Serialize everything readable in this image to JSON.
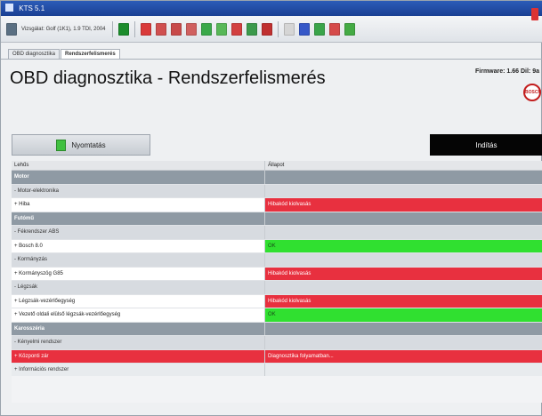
{
  "window": {
    "title": "KTS 5.1"
  },
  "toolbar": {
    "label": "Vizsgálat: Golf (1K1), 1.9 TDI, 2004",
    "buttons": [
      {
        "name": "nav-back-icon",
        "color": "#1c8c2c"
      },
      {
        "name": "stop-icon",
        "color": "#d93a3a"
      },
      {
        "name": "search-icon",
        "color": "#d05050"
      },
      {
        "name": "flash-icon",
        "color": "#c84a4a"
      },
      {
        "name": "info-icon",
        "color": "#d06060"
      },
      {
        "name": "grid-icon",
        "color": "#3aa84a"
      },
      {
        "name": "monitor-icon",
        "color": "#58b858"
      },
      {
        "name": "engine-icon",
        "color": "#d24040"
      },
      {
        "name": "chart-icon",
        "color": "#3c9a4c"
      },
      {
        "name": "gauge-icon",
        "color": "#c03030"
      },
      {
        "name": "doc-icon",
        "color": "#d5d5d5"
      },
      {
        "name": "help-icon",
        "color": "#3658c8"
      },
      {
        "name": "user-icon",
        "color": "#3aa44a"
      },
      {
        "name": "settings-icon",
        "color": "#d54a4a"
      },
      {
        "name": "exit-icon",
        "color": "#44aa44"
      }
    ]
  },
  "tabs": [
    {
      "label": "OBD diagnosztika",
      "active": false
    },
    {
      "label": "Rendszerfelismerés",
      "active": true
    }
  ],
  "page": {
    "title": "OBD diagnosztika - Rendszerfelismerés",
    "firmware": "Firmware: 1.66  Dil: 9a",
    "logo_text": "BOSCH"
  },
  "actions": {
    "print_label": "Nyomtatás",
    "back_label": "Indítás"
  },
  "table": {
    "columns": [
      "Lehűs",
      "Állapot"
    ],
    "rows": [
      {
        "type": "section",
        "c1": "Motor",
        "c2": ""
      },
      {
        "type": "group",
        "c1": "- Motor-elektronika",
        "c2": ""
      },
      {
        "type": "item err",
        "c1": "+ Hiba",
        "c2": "Hibakód kiolvasás"
      },
      {
        "type": "section",
        "c1": "Futómű",
        "c2": ""
      },
      {
        "type": "group",
        "c1": "- Fékrendszer ABS",
        "c2": ""
      },
      {
        "type": "item ok",
        "c1": "+ Bosch 8.0",
        "c2": "OK"
      },
      {
        "type": "group",
        "c1": "- Kormányzás",
        "c2": ""
      },
      {
        "type": "item err",
        "c1": "+ Kormányszög G85",
        "c2": "Hibakód kiolvasás"
      },
      {
        "type": "group",
        "c1": "- Légzsák",
        "c2": ""
      },
      {
        "type": "item err",
        "c1": "+ Légzsák-vezérlőegység",
        "c2": "Hibakód kiolvasás"
      },
      {
        "type": "item ok",
        "c1": "+ Vezető oldali elülső légzsák-vezérlőegység",
        "c2": "OK"
      },
      {
        "type": "section",
        "c1": "Karosszéria",
        "c2": ""
      },
      {
        "type": "group",
        "c1": "- Kényelmi rendszer",
        "c2": ""
      },
      {
        "type": "item selected",
        "c1": "+ Központi zár",
        "c2": "Diagnosztika folyamatban..."
      },
      {
        "type": "plain",
        "c1": "+ Információs rendszer",
        "c2": ""
      }
    ]
  }
}
